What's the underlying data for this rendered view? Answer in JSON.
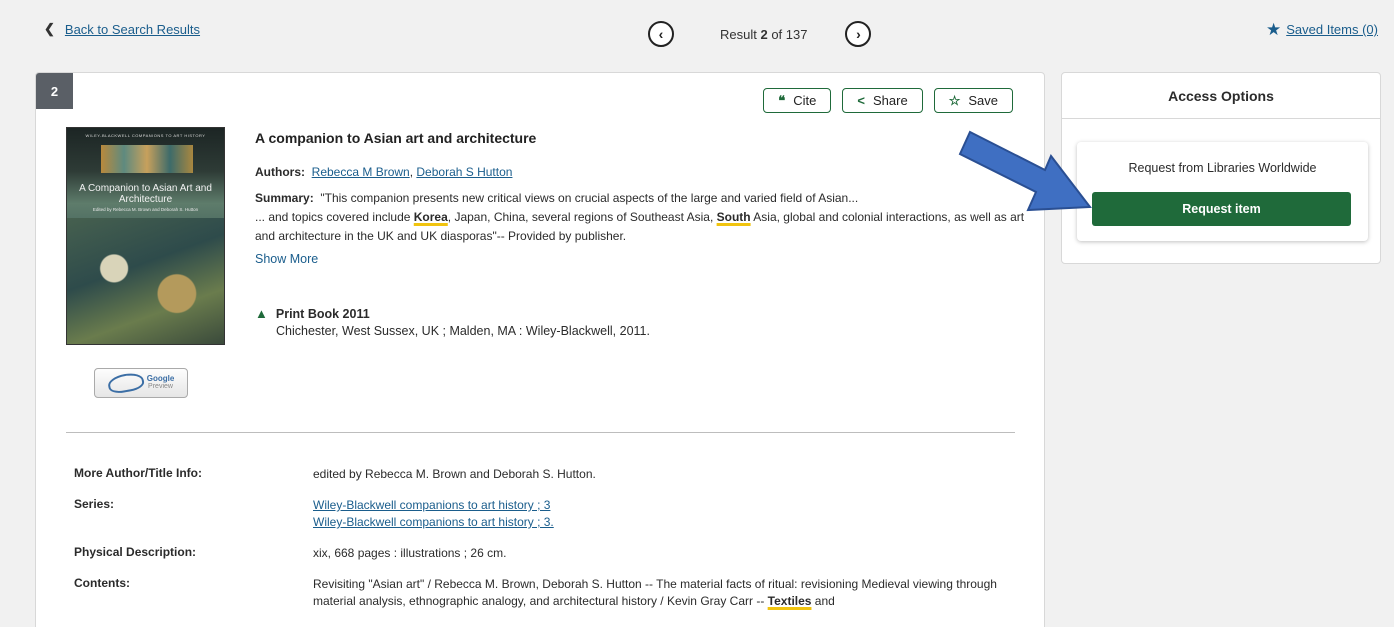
{
  "topbar": {
    "back_label": "Back to Search Results",
    "result_prefix": "Result ",
    "result_index": "2",
    "result_suffix": " of 137",
    "saved_label": "Saved Items (0)"
  },
  "record": {
    "badge": "2",
    "actions": {
      "cite": "Cite",
      "share": "Share",
      "save": "Save"
    },
    "title": "A companion to Asian art and architecture",
    "authors_label": "Authors:",
    "authors": [
      "Rebecca M Brown",
      "Deborah S Hutton"
    ],
    "summary_label": "Summary:",
    "summary_line1": "\"This companion presents new critical views on crucial aspects of the large and varied field of Asian...",
    "summary_part1": "... and topics covered include ",
    "summary_hl1": "Korea",
    "summary_part2": ", Japan, China, several regions of Southeast Asia, ",
    "summary_hl2": "South",
    "summary_part3": " Asia, global and colonial interactions, as well as art and architecture in the UK and UK diasporas\"-- Provided by publisher.",
    "show_more": "Show More",
    "format": "Print Book 2011",
    "publisher": "Chichester, West Sussex, UK ; Malden, MA : Wiley-Blackwell, 2011.",
    "cover": {
      "series_text": "WILEY-BLACKWELL COMPANIONS TO ART HISTORY",
      "title": "A Companion to Asian Art and Architecture",
      "subtitle": "Edited by Rebecca M. Brown and Deborah S. Hutton"
    },
    "google_preview": {
      "brand": "Google",
      "label": "Preview"
    }
  },
  "info": {
    "more_label": "More Author/Title Info:",
    "more_value": "edited by Rebecca M. Brown and Deborah S. Hutton.",
    "series_label": "Series:",
    "series_values": [
      "Wiley-Blackwell companions to art history ; 3",
      "Wiley-Blackwell companions to art history ; 3."
    ],
    "physical_label": "Physical Description:",
    "physical_value": "xix, 668 pages : illustrations ; 26 cm.",
    "contents_label": "Contents:",
    "contents_part1": "Revisiting \"Asian art\" / Rebecca M. Brown, Deborah S. Hutton -- The material facts of ritual: revisioning Medieval viewing through material analysis, ethnographic analogy, and architectural history / Kevin Gray Carr -- ",
    "contents_hl": "Textiles",
    "contents_part2": " and"
  },
  "access": {
    "header": "Access Options",
    "request_label": "Request from Libraries Worldwide",
    "request_button": "Request item"
  },
  "colors": {
    "accent_green": "#1f6a3a",
    "link_blue": "#1a5d8c",
    "arrow_blue": "#3f6fc2"
  }
}
